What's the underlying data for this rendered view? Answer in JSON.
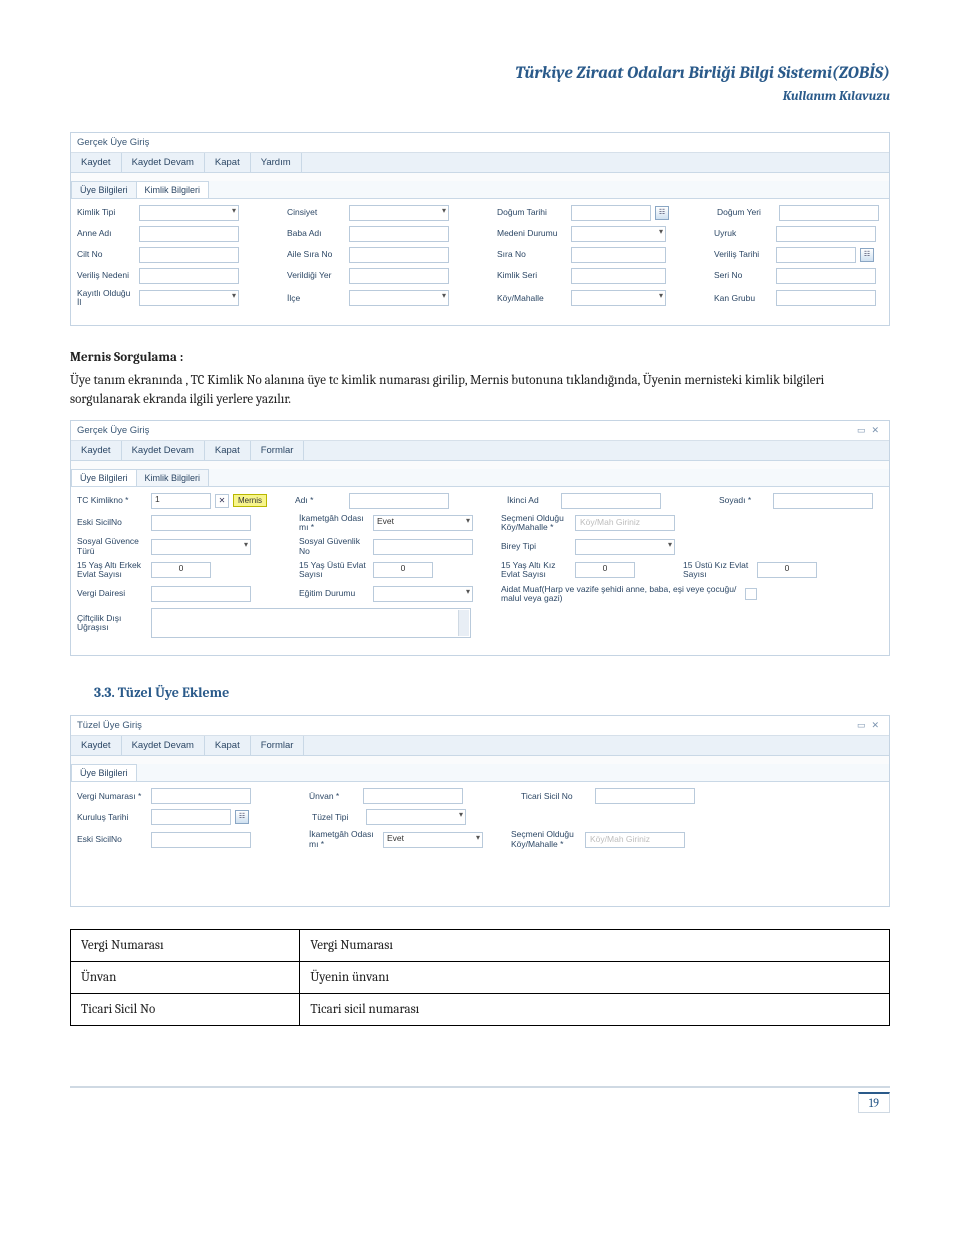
{
  "header": {
    "title": "Türkiye Ziraat Odaları Birliği Bilgi Sistemi(ZOBİS)",
    "subtitle": "Kullanım Kılavuzu"
  },
  "screenshot1": {
    "windowTitle": "Gerçek Üye Giriş",
    "toolbar": [
      "Kaydet",
      "Kaydet Devam",
      "Kapat",
      "Yardım"
    ],
    "tabs": [
      "Üye Bilgileri",
      "Kimlik Bilgileri"
    ],
    "labels": {
      "kimlikTipi": "Kimlik Tipi",
      "cinsiyet": "Cinsiyet",
      "dogumTarihi": "Doğum Tarihi",
      "dogumYeri": "Doğum Yeri",
      "anneAdi": "Anne Adı",
      "babaAdi": "Baba Adı",
      "medeniDurumu": "Medeni Durumu",
      "uyruk": "Uyruk",
      "ciltNo": "Cilt No",
      "aileSiraNo": "Aile Sıra No",
      "siraNo": "Sıra No",
      "verilisTarihi": "Veriliş Tarihi",
      "verilisNedeni": "Veriliş Nedeni",
      "verildigiYer": "Verildiği Yer",
      "kimlikSeri": "Kimlik Seri",
      "seriNo": "Seri No",
      "kayitliOlduguIl": "Kayıtlı Olduğu İl",
      "ilce": "İlçe",
      "koyMahalle": "Köy/Mahalle",
      "kanGrubu": "Kan Grubu"
    }
  },
  "section_mernis": {
    "heading": "Mernis Sorgulama :",
    "paragraph": "Üye tanım ekranında , TC Kimlik No alanına üye tc kimlik numarası girilip, Mernis butonuna tıklandığında, Üyenin mernisteki kimlik bilgileri sorgulanarak ekranda  ilgili yerlere yazılır."
  },
  "screenshot2": {
    "windowTitle": "Gerçek Üye Giriş",
    "windowControls": {
      "min": "▭",
      "close": "✕"
    },
    "toolbar": [
      "Kaydet",
      "Kaydet Devam",
      "Kapat",
      "Formlar"
    ],
    "tabs": [
      "Üye Bilgileri",
      "Kimlik Bilgileri"
    ],
    "labels": {
      "tcKimlikNo": "TC Kimlikno *",
      "tcValue": "1",
      "xBtn": "✕",
      "mernis": "Mernis",
      "adi": "Adı *",
      "ikinciAd": "İkinci Ad",
      "soyadi": "Soyadı *",
      "eskiSicilNo": "Eski SicilNo",
      "ikametgahOdasi": "İkametgâh Odası mı *",
      "evet": "Evet",
      "secmeniOlduguKoyMahalle": "Seçmeni Olduğu Köy/Mahalle *",
      "koyMahPlaceholder": "Köy/Mah Giriniz",
      "sosyalGuvenceTuru": "Sosyal Güvence Türü",
      "sosyalGuvenlikNo": "Sosyal Güvenlik No",
      "bireyTipi": "Birey Tipi",
      "yas15AltiErkek": "15 Yaş Altı Erkek Evlat Sayısı",
      "yas15UstuEvlat": "15 Yaş Üstü Evlat Sayısı",
      "yas15AltiKiz": "15 Yaş Altı Kız Evlat Sayısı",
      "yas15UstuKiz": "15 Üstü Kız Evlat Sayısı",
      "zero": "0",
      "vergiDairesi": "Vergi Dairesi",
      "egitimDurumu": "Eğitim Durumu",
      "aidatMuaf": "Aidat Muaf(Harp ve vazife şehidi anne, baba, eşi veye çocuğu/ malul veya gazi)",
      "ciftcilikDisi": "Çiftçilik Dışı Uğraşısı"
    }
  },
  "section33": {
    "title": "3.3. Tüzel Üye Ekleme"
  },
  "screenshot3": {
    "windowTitle": "Tüzel Üye Giriş",
    "windowControls": {
      "min": "▭",
      "close": "✕"
    },
    "toolbar": [
      "Kaydet",
      "Kaydet Devam",
      "Kapat",
      "Formlar"
    ],
    "tabs": [
      "Üye Bilgileri"
    ],
    "labels": {
      "vergiNumarasi": "Vergi Numarası *",
      "unvan": "Ünvan *",
      "ticariSicilNo": "Ticari Sicil No",
      "kurulusTarihi": "Kuruluş Tarihi",
      "tuzelTipi": "Tüzel Tipi",
      "eskiSicilNo": "Eski SicilNo",
      "ikametgahOdasi": "İkametgâh Odası mı *",
      "evet": "Evet",
      "secmeniOlduguKoyMahalle": "Seçmeni Olduğu Köy/Mahalle *",
      "koyMahPlaceholder": "Köy/Mah Giriniz"
    }
  },
  "descTable": {
    "r1c1": "Vergi  Numarası",
    "r1c2": "Vergi Numarası",
    "r2c1": "Ünvan",
    "r2c2": "Üyenin ünvanı",
    "r3c1": "Ticari Sicil No",
    "r3c2": "Ticari sicil numarası"
  },
  "footer": {
    "pageNumber": "19"
  }
}
